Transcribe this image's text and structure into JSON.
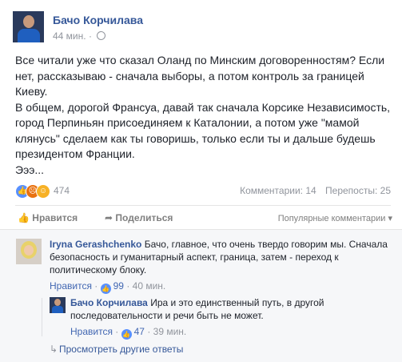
{
  "post": {
    "author": "Бачо Корчилава",
    "time": "44 мин.",
    "paragraphs": [
      "Все читали уже что сказал Оланд по Минским договоренностям? Если нет, рассказываю - сначала выборы, а потом контроль за границей Киеву.",
      "В общем, дорогой Франсуа, давай так сначала Корсике Независимость, город Перпиньян присоединяем к Каталонии, а потом уже \"мамой клянусь\" сделаем как ты говоришь, только если ты и дальше будешь президентом Франции.",
      "Эээ..."
    ],
    "reaction_count": "474",
    "comments_stat": "Комментарии: 14",
    "shares_stat": "Перепосты: 25"
  },
  "actions": {
    "like_label": "Нравится",
    "share_label": "Поделиться",
    "sort_label": "Популярные комментарии"
  },
  "comments": [
    {
      "name": "Iryna Gerashchenko",
      "text": "Бачо, главное, что очень твердо говорим мы. Сначала безопасность и гуманитарный аспект, граница, затем - переход к политическому блоку.",
      "like_label": "Нравится",
      "likes": "99",
      "time": "40 мин."
    },
    {
      "name": "Бачо Корчилава",
      "text": "Ира и это единственный путь, в другой последовательности и речи быть не может.",
      "like_label": "Нравится",
      "likes": "47",
      "time": "39 мин."
    }
  ],
  "more_replies": "Просмотреть другие ответы",
  "colors": {
    "link_blue": "#365899",
    "like_blue": "#5890ff",
    "angry_orange": "#e9710f",
    "haha_yellow": "#f7b125",
    "meta_gray": "#90949c"
  }
}
